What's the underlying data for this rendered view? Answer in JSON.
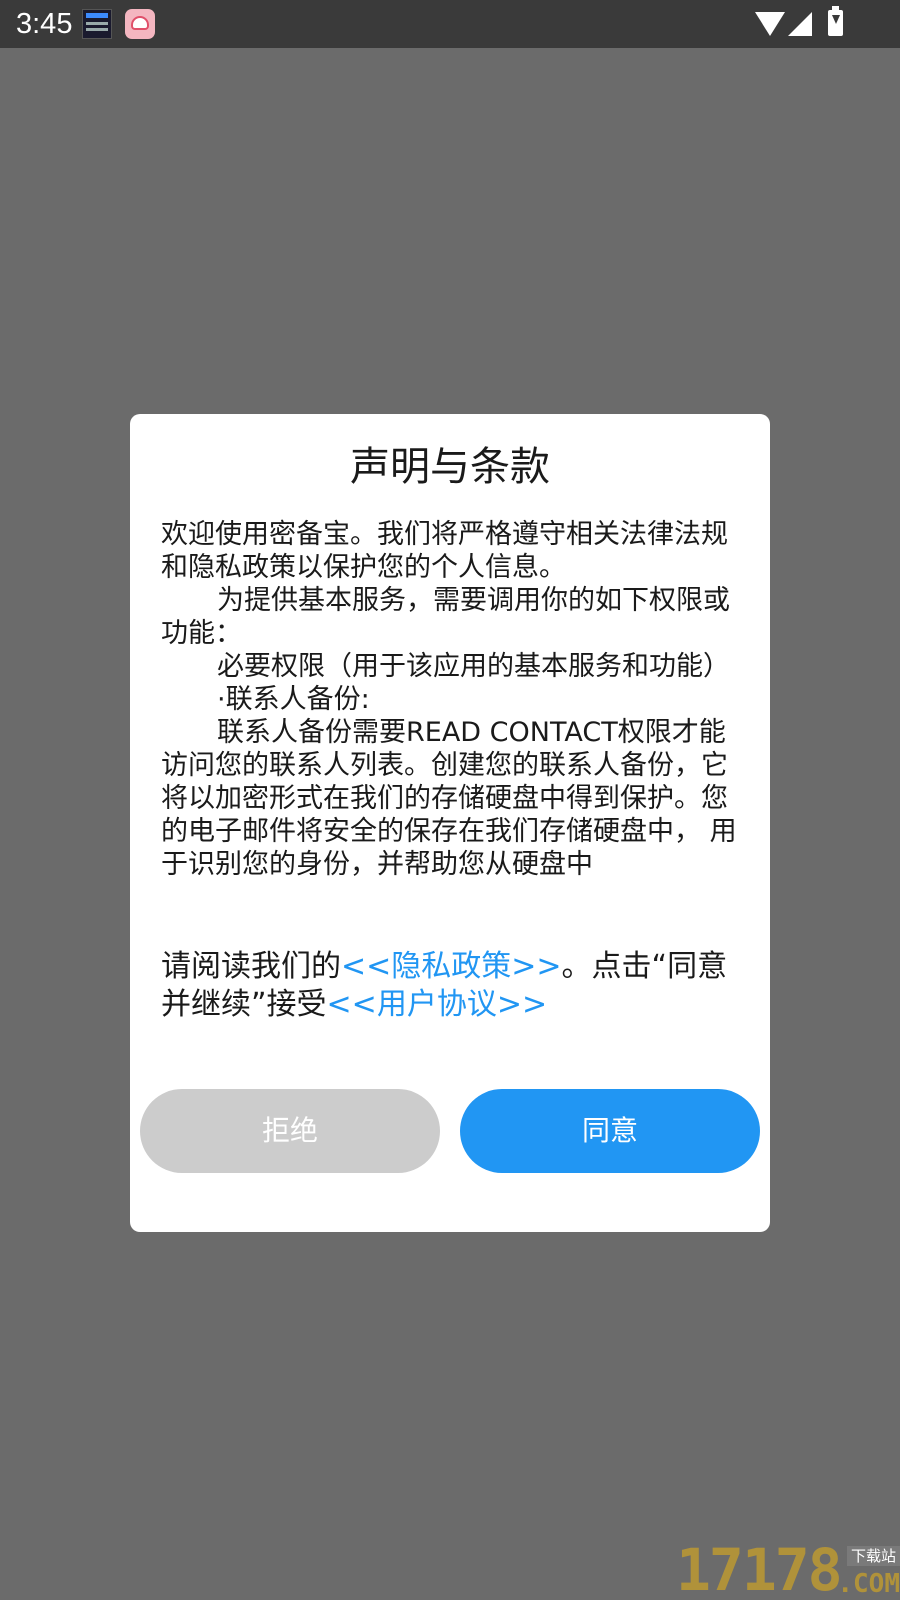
{
  "status_bar": {
    "time": "3:45"
  },
  "dialog": {
    "title": "声明与条款",
    "paragraphs": [
      "欢迎使用密备宝。我们将严格遵守相关法律法规和隐私政策以保护您的个人信息。",
      "为提供基本服务，需要调用你的如下权限或功能：",
      "必要权限（用于该应用的基本服务和功能）",
      "·联系人备份:",
      "联系人备份需要READ CONTACT权限才能访问您的联系人列表。创建您的联系人备份，它将以加密形式在我们的存储硬盘中得到保护。您的电子邮件将安全的保存在我们存储硬盘中， 用于识别您的身份，并帮助您从硬盘中"
    ],
    "notice": {
      "prefix": "请阅读我们的",
      "privacy_link": "<<隐私政策>>",
      "middle": "。点击“同意并继续”接受",
      "agreement_link": "<<用户协议>>"
    },
    "reject_label": "拒绝",
    "agree_label": "同意"
  },
  "colors": {
    "accent": "#2196f3",
    "reject_button": "#cccccc",
    "overlay": "#6b6b6b"
  },
  "watermark": {
    "number": "17178",
    "tag": "下载站",
    "suffix": ".COM"
  }
}
